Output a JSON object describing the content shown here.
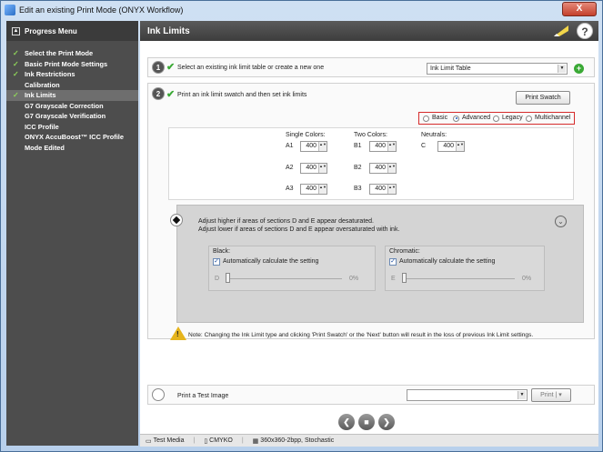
{
  "window": {
    "title": "Edit an existing Print Mode (ONYX Workflow)",
    "close_label": "X"
  },
  "sidebar": {
    "header": "Progress Menu",
    "items": [
      {
        "label": "Select the Print Mode",
        "checked": true
      },
      {
        "label": "Basic Print Mode Settings",
        "checked": true
      },
      {
        "label": "Ink Restrictions",
        "checked": true
      },
      {
        "label": "Calibration",
        "checked": false
      },
      {
        "label": "Ink Limits",
        "checked": true,
        "active": true
      },
      {
        "label": "G7 Grayscale Correction",
        "checked": false
      },
      {
        "label": "G7 Grayscale Verification",
        "checked": false
      },
      {
        "label": "ICC Profile",
        "checked": false
      },
      {
        "label": "ONYX AccuBoost™ ICC Profile",
        "checked": false
      },
      {
        "label": "Mode Edited",
        "checked": false
      }
    ]
  },
  "main": {
    "title": "Ink Limits",
    "help_icon": "?"
  },
  "step1": {
    "number": "1",
    "text": "Select an existing ink limit table or create a new one",
    "dropdown_value": "Ink Limit Table",
    "add": "+"
  },
  "step2": {
    "number": "2",
    "text": "Print an ink limit swatch and then set ink limits",
    "print_swatch": "Print Swatch",
    "modes": [
      {
        "label": "Basic",
        "selected": false
      },
      {
        "label": "Advanced",
        "selected": true
      },
      {
        "label": "Legacy",
        "selected": false
      },
      {
        "label": "Multichannel",
        "selected": false
      }
    ],
    "single_colors": {
      "header": "Single Colors:",
      "rows": [
        {
          "label": "A1",
          "value": "400"
        },
        {
          "label": "A2",
          "value": "400"
        },
        {
          "label": "A3",
          "value": "400"
        }
      ]
    },
    "two_colors": {
      "header": "Two Colors:",
      "rows": [
        {
          "label": "B1",
          "value": "400"
        },
        {
          "label": "B2",
          "value": "400"
        },
        {
          "label": "B3",
          "value": "400"
        }
      ]
    },
    "neutrals": {
      "header": "Neutrals:",
      "rows": [
        {
          "label": "C",
          "value": "400"
        }
      ]
    },
    "adjust_line1": "Adjust higher if areas of sections D and E appear desaturated.",
    "adjust_line2": "Adjust lower if areas of sections D and E appear oversaturated with ink.",
    "black": {
      "title": "Black:",
      "auto_label": "Automatically calculate the setting",
      "letter": "D",
      "value": "0%"
    },
    "chromatic": {
      "title": "Chromatic:",
      "auto_label": "Automatically calculate the setting",
      "letter": "E",
      "value": "0%"
    },
    "note": "Note: Changing the Ink Limit type and clicking 'Print Swatch' or the 'Next' button will result in the loss of previous Ink Limit settings."
  },
  "step3": {
    "text": "Print a Test Image",
    "dropdown_value": "",
    "print_label": "Print"
  },
  "status": {
    "media": "Test Media",
    "colorspace": "CMYKO",
    "resolution": "360x360-2bpp, Stochastic"
  }
}
